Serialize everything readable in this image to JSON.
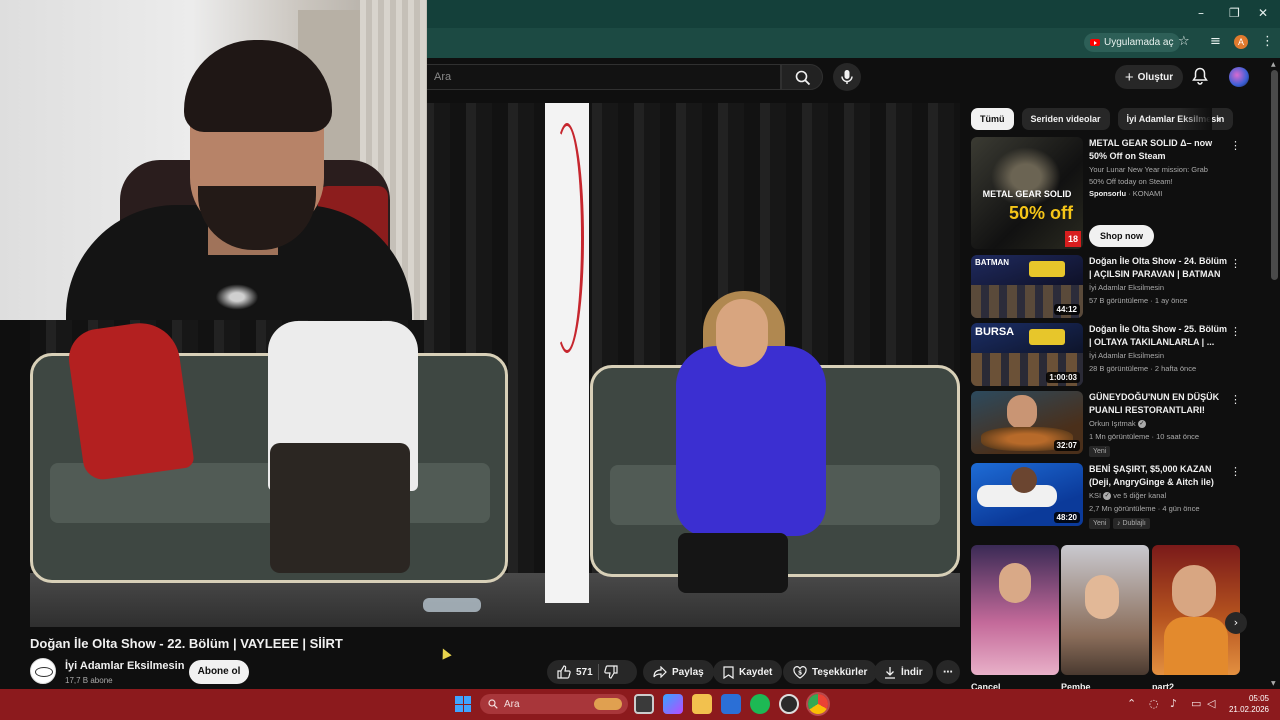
{
  "browser": {
    "open_in_app_label": "Uygulamada aç",
    "profile_initial": "A"
  },
  "header": {
    "search_placeholder": "Ara",
    "create_label": "Oluştur"
  },
  "video": {
    "title": "Doğan İle Olta Show - 22. Bölüm | VAYLEEE | SİİRT",
    "channel_name": "İyi Adamlar Eksilmesin",
    "subscribers": "17,7 B abone",
    "subscribe_label": "Abone ol",
    "like_count": "571",
    "share_label": "Paylaş",
    "save_label": "Kaydet",
    "thanks_label": "Teşekkürler",
    "download_label": "İndir"
  },
  "chips": [
    "Tümü",
    "Seriden videolar",
    "İyi Adamlar Eksilmesin"
  ],
  "recommendations": [
    {
      "title": "METAL GEAR SOLID Δ– now 50% Off on Steam",
      "line1": "Your Lunar New Year mission: Grab",
      "line2": "50% Off today on Steam!",
      "sponsor_label": "Sponsorlu",
      "sponsor_name": "· KONAMI",
      "thumb_text": "METAL GEAR SOLID",
      "thumb_discount": "50% off",
      "thumb_rating": "18",
      "cta": "Shop now"
    },
    {
      "title": "Doğan İle Olta Show - 24. Bölüm | AÇILSIN PARAVAN | BATMAN",
      "channel": "İyi Adamlar Eksilmesin",
      "meta": "57 B görüntüleme · 1 ay önce",
      "duration": "44:12",
      "thumb_text": "BATMAN"
    },
    {
      "title": "Doğan İle Olta Show - 25. Bölüm | OLTAYA TAKILANLARLA | ...",
      "channel": "İyi Adamlar Eksilmesin",
      "meta": "28 B görüntüleme · 2 hafta önce",
      "duration": "1:00:03",
      "thumb_text": "BURSA"
    },
    {
      "title": "GÜNEYDOĞU'NUN EN DÜŞÜK PUANLI RESTORANTLARI!",
      "channel": "Orkun Işıtmak",
      "meta": "1 Mn görüntüleme · 10 saat önce",
      "badge": "Yeni",
      "duration": "32:07"
    },
    {
      "title": "BENİ ŞAŞIRT, $5,000 KAZAN (Deji, AngryGinge & Aitch ile)",
      "channel": "KSI",
      "channel_extra": "ve 5 diğer kanal",
      "meta": "2,7 Mn görüntüleme · 4 gün önce",
      "badge": "Yeni",
      "badge2": "Dublajlı",
      "duration": "48:20"
    }
  ],
  "shorts": [
    {
      "caption": "Cancel"
    },
    {
      "caption": "Pembe"
    },
    {
      "caption": "part2"
    }
  ],
  "taskbar": {
    "search_label": "Ara",
    "time": "05:05",
    "date": "21.02.2026"
  },
  "colors": {
    "titlebar": "#14403a",
    "taskbar": "#8c1a1d",
    "page_bg": "#0f0f0f",
    "accent_red": "#ff0000"
  }
}
